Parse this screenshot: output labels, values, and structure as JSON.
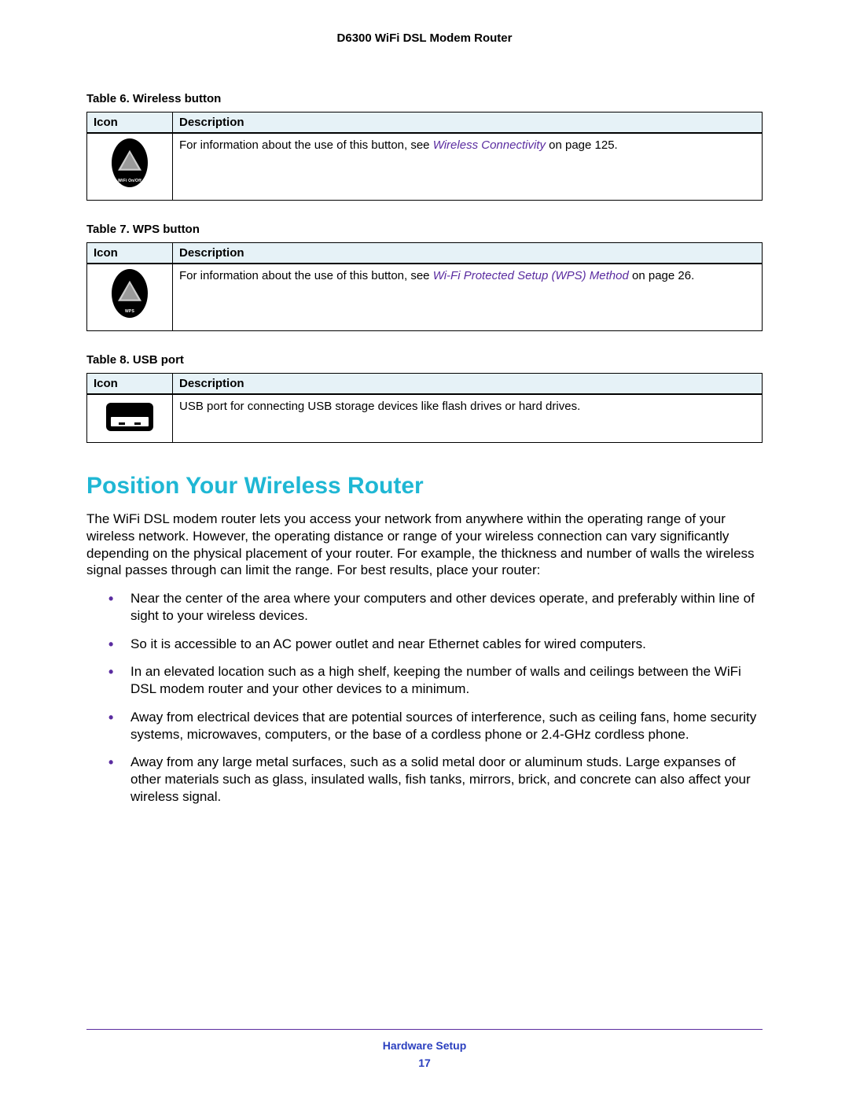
{
  "header": {
    "title": "D6300 WiFi DSL Modem Router"
  },
  "tables": {
    "t6": {
      "caption": "Table 6.  Wireless button",
      "cols": {
        "icon": "Icon",
        "desc": "Description"
      },
      "desc_prefix": "For information about the use of this button, see ",
      "desc_link": "Wireless Connectivity",
      "desc_suffix": " on page 125.",
      "icon_label": "WiFi On/Off"
    },
    "t7": {
      "caption": "Table 7.  WPS button",
      "cols": {
        "icon": "Icon",
        "desc": "Description"
      },
      "desc_prefix": "For information about the use of this button, see ",
      "desc_link": "Wi-Fi Protected Setup (WPS) Method",
      "desc_suffix": " on page 26.",
      "icon_label": "WPS"
    },
    "t8": {
      "caption": "Table 8.  USB port",
      "cols": {
        "icon": "Icon",
        "desc": "Description"
      },
      "desc": "USB port for connecting USB storage devices like flash drives or hard drives."
    }
  },
  "section": {
    "title": "Position Your Wireless Router",
    "intro": "The WiFi DSL modem router lets you access your network from anywhere within the operating range of your wireless network. However, the operating distance or range of your wireless connection can vary significantly depending on the physical placement of your router. For example, the thickness and number of walls the wireless signal passes through can limit the range. For best results, place your router:",
    "bullets": [
      "Near the center of the area where your computers and other devices operate, and preferably within line of sight to your wireless devices.",
      "So it is accessible to an AC power outlet and near Ethernet cables for wired computers.",
      "In an elevated location such as a high shelf, keeping the number of walls and ceilings between the WiFi DSL modem router and your other devices to a minimum.",
      "Away from electrical devices that are potential sources of interference, such as ceiling fans, home security systems, microwaves, computers, or the base of a cordless phone or 2.4-GHz cordless phone.",
      "Away from any large metal surfaces, such as a solid metal door or aluminum studs. Large expanses of other materials such as glass, insulated walls, fish tanks, mirrors, brick, and concrete can also affect your wireless signal."
    ]
  },
  "footer": {
    "label": "Hardware Setup",
    "page": "17"
  }
}
